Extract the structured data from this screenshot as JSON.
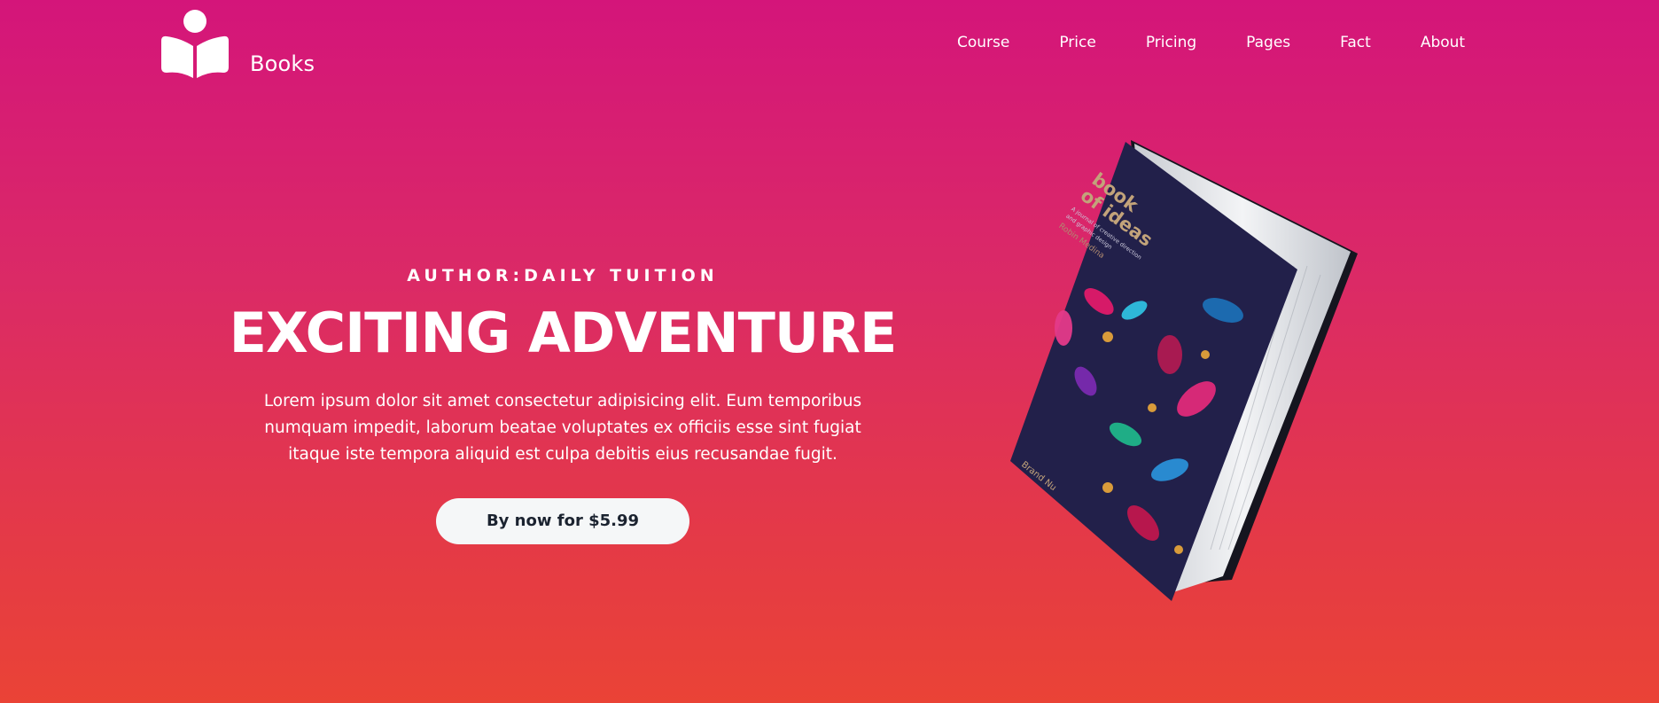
{
  "brand": {
    "name": "Books",
    "icon": "open-book-reader-icon"
  },
  "nav": {
    "items": [
      "Course",
      "Price",
      "Pricing",
      "Pages",
      "Fact",
      "About"
    ]
  },
  "hero": {
    "author": "AUTHOR:DAILY TUITION",
    "title": "EXCITING ADVENTURE",
    "description": "Lorem ipsum dolor sit amet consectetur adipisicing elit. Eum temporibus numquam impedit, laborum beatae voluptates ex officiis esse sint fugiat itaque iste tempora aliquid est culpa debitis eius recusandae fugit.",
    "cta_label": "By now for $5.99"
  },
  "book": {
    "title": "book of ideas",
    "subtitle": "A journal of creative direction and graphic design",
    "editor": "Robin Medina",
    "publisher": "Brand Nu"
  },
  "colors": {
    "gradient_top": "#d4157a",
    "gradient_bottom": "#ea4336",
    "button_bg": "#f5f7f8",
    "button_text": "#1b2330",
    "book_cover": "#22204a"
  }
}
